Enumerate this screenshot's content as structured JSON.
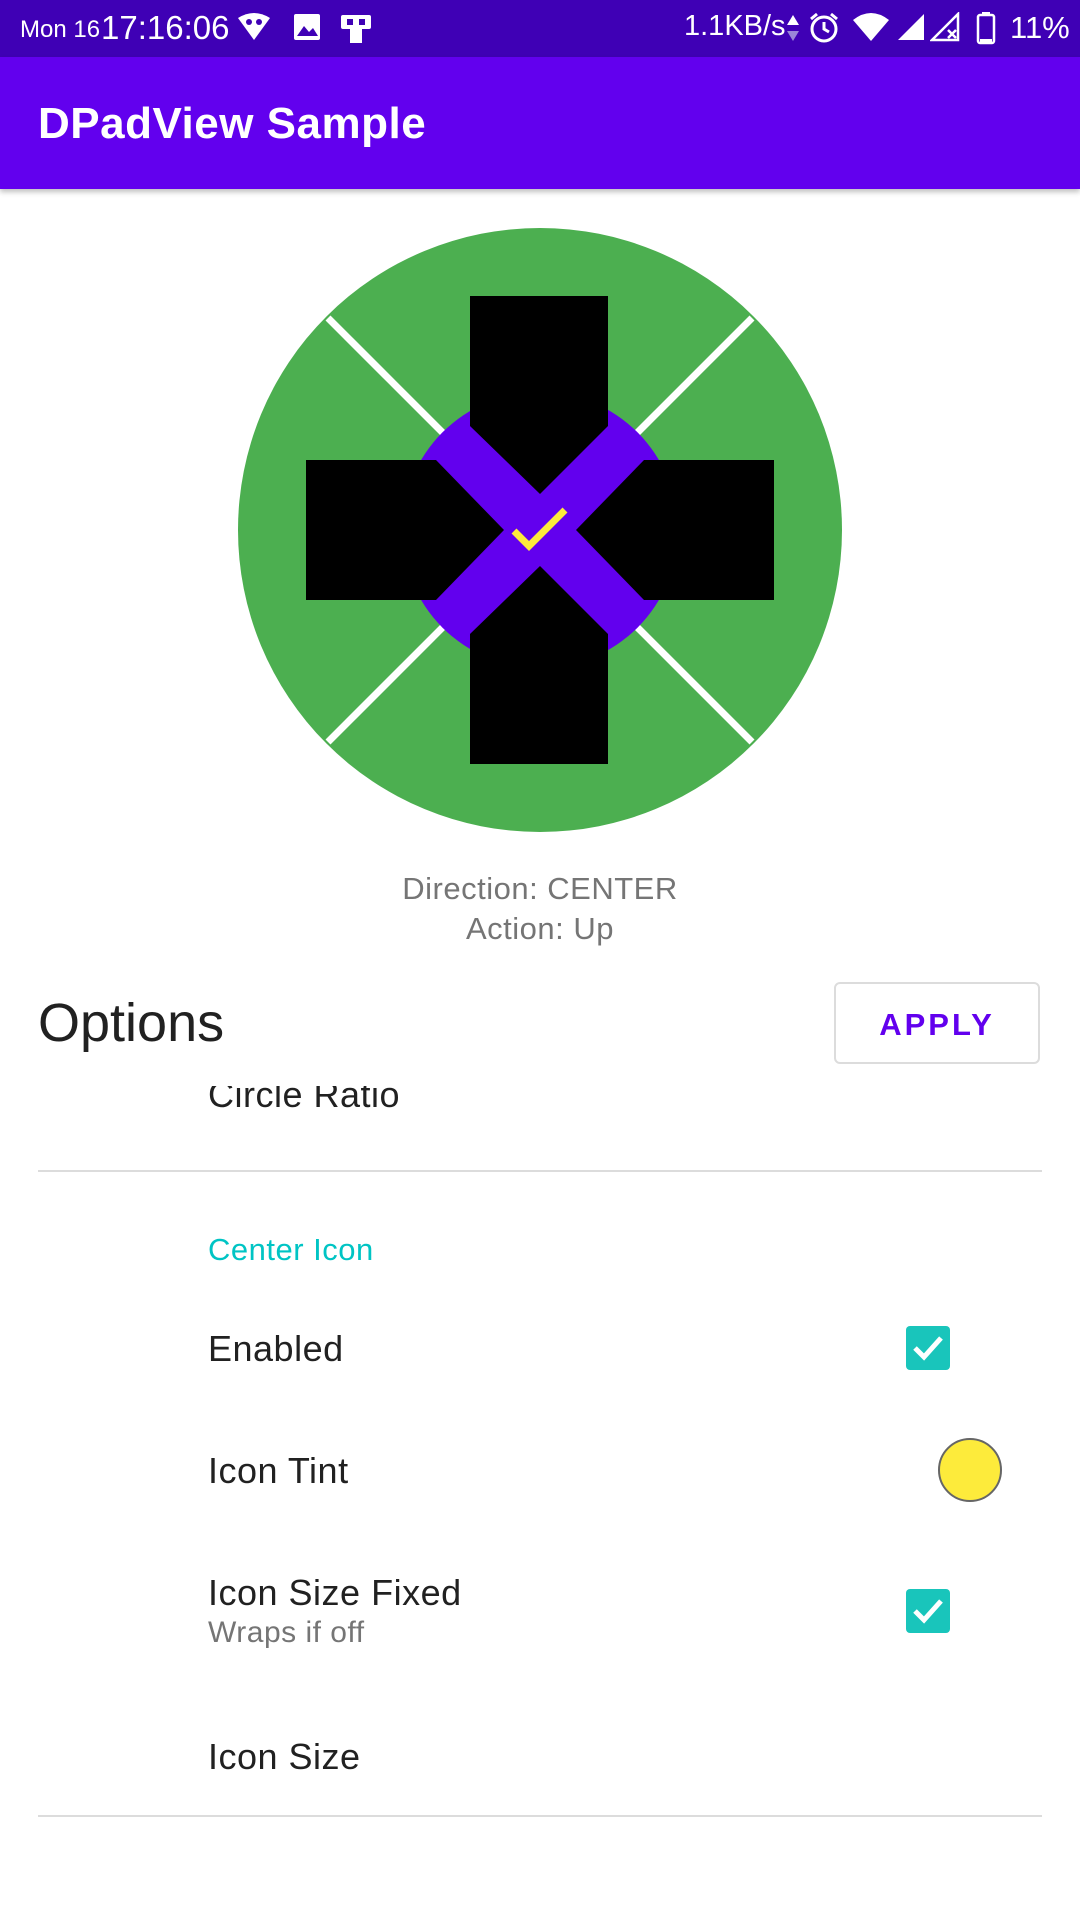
{
  "status_bar": {
    "day": "Mon 16",
    "time": "17:16:06",
    "net_speed": "1.1KB/s",
    "battery": "11%",
    "icons": [
      "vpn-icon",
      "image-icon",
      "usb-icon",
      "data-arrows-icon",
      "alarm-icon",
      "wifi-icon",
      "signal-icon",
      "signal-no-data-icon",
      "battery-icon"
    ]
  },
  "app_bar": {
    "title": "DPadView Sample"
  },
  "dpad": {
    "colors": {
      "ring": "#4caf50",
      "center": "#6200ee",
      "arrows": "#000000",
      "center_icon": "#fdeb3b",
      "separator": "#ffffff"
    },
    "center_icon": "check-icon"
  },
  "readout": {
    "direction": "Direction:  CENTER",
    "action": "Action:  Up"
  },
  "options": {
    "title": "Options",
    "apply_label": "APPLY"
  },
  "preferences": {
    "circle_ratio": "Circle Ratio",
    "center_icon_category": "Center Icon",
    "enabled": {
      "label": "Enabled",
      "checked": true
    },
    "icon_tint": {
      "label": "Icon Tint",
      "color": "#fdeb3b"
    },
    "icon_size_fixed": {
      "label": "Icon Size Fixed",
      "summary": "Wraps if off",
      "checked": true
    },
    "icon_size": "Icon Size"
  },
  "colors": {
    "status_bar": "#3f00b5",
    "app_bar": "#6200ee",
    "accent": "#19c5bb",
    "category": "#00c4c4"
  }
}
